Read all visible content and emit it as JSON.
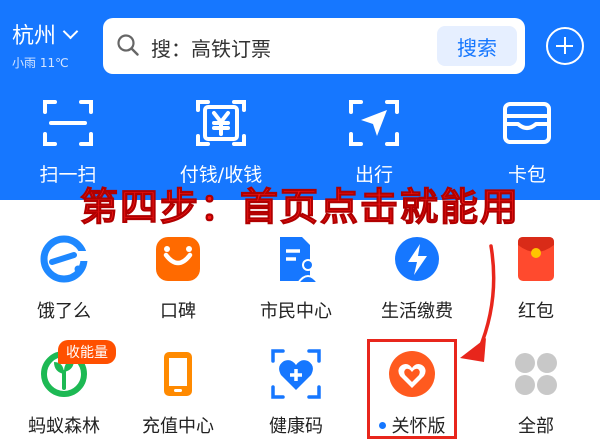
{
  "header": {
    "city": "杭州",
    "weather": "小雨 11℃",
    "search_placeholder": "搜：高铁订票",
    "search_button": "搜索"
  },
  "quick_actions": [
    {
      "label": "扫一扫",
      "icon": "scan-icon"
    },
    {
      "label": "付钱/收钱",
      "icon": "pay-yen-icon"
    },
    {
      "label": "出行",
      "icon": "travel-arrow-icon"
    },
    {
      "label": "卡包",
      "icon": "card-wallet-icon"
    }
  ],
  "overlay_text": "第四步：首页点击就能用",
  "services_row1": [
    {
      "label": "饿了么",
      "icon": "eleme-icon"
    },
    {
      "label": "口碑",
      "icon": "koubei-icon"
    },
    {
      "label": "市民中心",
      "icon": "citizen-center-icon"
    },
    {
      "label": "生活缴费",
      "icon": "bill-payment-icon"
    },
    {
      "label": "红包",
      "icon": "red-envelope-icon"
    }
  ],
  "services_row2": [
    {
      "label": "蚂蚁森林",
      "icon": "ant-forest-icon",
      "badge": "收能量"
    },
    {
      "label": "充值中心",
      "icon": "recharge-icon"
    },
    {
      "label": "健康码",
      "icon": "health-code-icon"
    },
    {
      "label": "关怀版",
      "icon": "care-mode-icon"
    },
    {
      "label": "全部",
      "icon": "all-apps-icon"
    }
  ],
  "colors": {
    "brand_blue": "#1677ff",
    "annotation_red": "#e8261c",
    "step_text_red": "#ff1a1a"
  }
}
